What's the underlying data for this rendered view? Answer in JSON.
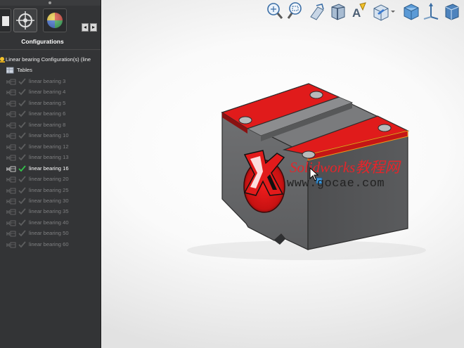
{
  "panel": {
    "title": "Configurations",
    "root": "Linear bearing Configuration(s)  (line",
    "tables": "Tables",
    "configs": [
      {
        "label": "linear bearing 3",
        "active": false
      },
      {
        "label": "linear bearing 4",
        "active": false
      },
      {
        "label": "linear bearing 5",
        "active": false
      },
      {
        "label": "linear bearing 6",
        "active": false
      },
      {
        "label": "linear bearing 8",
        "active": false
      },
      {
        "label": "linear bearing 10",
        "active": false
      },
      {
        "label": "linear bearing 12",
        "active": false
      },
      {
        "label": "linear bearing 13",
        "active": false
      },
      {
        "label": "linear bearing 16",
        "active": true
      },
      {
        "label": "linear bearing 20",
        "active": false
      },
      {
        "label": "linear bearing 25",
        "active": false
      },
      {
        "label": "linear bearing 30",
        "active": false
      },
      {
        "label": "linear bearing 35",
        "active": false
      },
      {
        "label": "linear bearing 40",
        "active": false
      },
      {
        "label": "linear bearing 50",
        "active": false
      },
      {
        "label": "linear bearing 60",
        "active": false
      }
    ],
    "tabs": [
      "featuremanager-icon",
      "dimxpert-icon",
      "display-manager-icon"
    ]
  },
  "toolbar": {
    "icons": [
      "zoom-to-fit-icon",
      "zoom-to-area-icon",
      "previous-view-icon",
      "section-view-icon",
      "dynamic-annotation-icon",
      "view-orientation-icon",
      "display-style-icon",
      "view-triad-icon"
    ]
  },
  "watermark": {
    "title": "Solidworks教程网",
    "url": "www.gocae.com"
  },
  "colors": {
    "panel_bg": "#333436",
    "face_red": "#e01b1b",
    "body_gray": "#6a6b6d",
    "selection_orange": "#f29a18",
    "active_check": "#33c24a"
  }
}
